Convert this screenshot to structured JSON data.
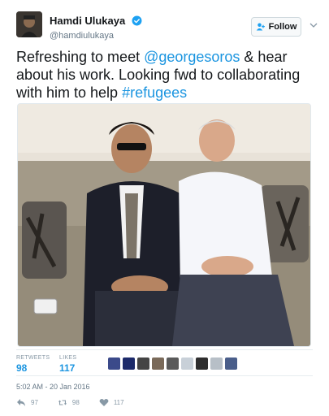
{
  "user": {
    "name": "Hamdi Ulukaya",
    "handle": "@hamdiulukaya",
    "follow_label": "Follow"
  },
  "tweet": {
    "text_parts": [
      {
        "text": "Refreshing to meet ",
        "type": "text"
      },
      {
        "text": "@georgesoros",
        "type": "link"
      },
      {
        "text": " & hear about his work. Looking fwd to collaborating with him to help ",
        "type": "text"
      },
      {
        "text": "#refugees",
        "type": "link"
      }
    ]
  },
  "stats": {
    "retweets_label": "RETWEETS",
    "retweets_value": "98",
    "likes_label": "LIKES",
    "likes_value": "117"
  },
  "timestamp": "5:02 AM - 20 Jan 2016",
  "actions": {
    "reply_count": "97",
    "retweet_count": "98",
    "like_count": "117"
  },
  "colors": {
    "link": "#1b95e0",
    "verified": "#1da1f2"
  },
  "icons": [
    "verified-badge-icon",
    "follow-person-icon",
    "chevron-down-icon",
    "reply-icon",
    "retweet-icon",
    "heart-icon"
  ]
}
